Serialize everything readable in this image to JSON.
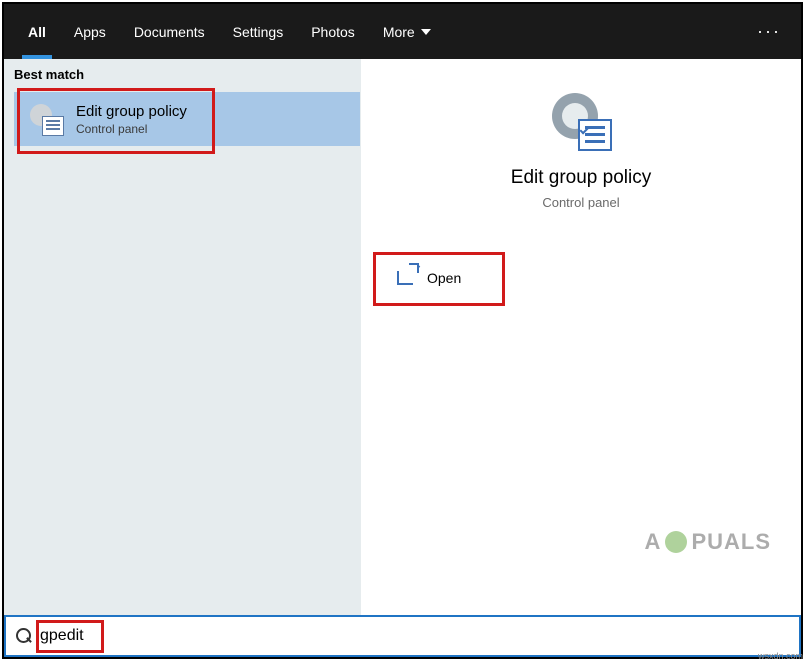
{
  "topbar": {
    "tabs": [
      {
        "label": "All",
        "active": true
      },
      {
        "label": "Apps"
      },
      {
        "label": "Documents"
      },
      {
        "label": "Settings"
      },
      {
        "label": "Photos"
      },
      {
        "label": "More"
      }
    ],
    "more_has_chevron": true,
    "overflow_glyph": "···"
  },
  "left_pane": {
    "section_header": "Best match",
    "result": {
      "title": "Edit group policy",
      "subtitle": "Control panel",
      "icon": "group-policy-icon"
    }
  },
  "right_pane": {
    "title": "Edit group policy",
    "subtitle": "Control panel",
    "icon": "group-policy-icon",
    "actions": [
      {
        "label": "Open",
        "icon": "open-external-icon"
      }
    ]
  },
  "search": {
    "placeholder": "",
    "value": "gpedit",
    "icon": "search-icon"
  },
  "watermark": {
    "prefix": "A",
    "suffix": "PUALS"
  },
  "corner_text": "wsxdn.com",
  "colors": {
    "topbar_bg": "#1a1a1a",
    "accent": "#3393df",
    "selection_bg": "#a7c7e7",
    "left_bg": "#e6ecee",
    "search_border": "#1f74c4",
    "annotation": "#d11a1a"
  }
}
